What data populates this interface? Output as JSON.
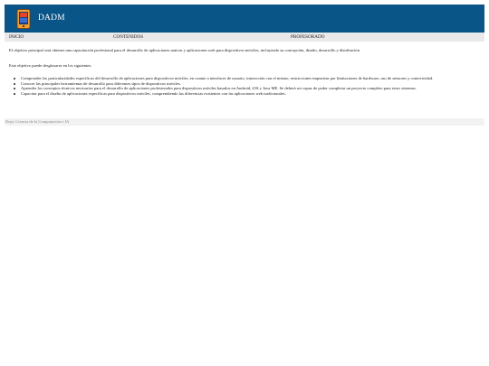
{
  "header": {
    "title": "DADM",
    "logo_icon": "device-logo-icon",
    "background_color": "#0a5587"
  },
  "nav": {
    "items": [
      {
        "label": "INICIO"
      },
      {
        "label": "CONTENIDOS"
      },
      {
        "label": "PROFESORADO"
      }
    ]
  },
  "main": {
    "intro": "El objetivo principal será obtener una capacitación profesional para el desarrollo de aplicaciones nativas y aplicaciones web para dispositivos móviles, incluyendo su concepción, diseño, desarrollo y distribución.",
    "lead": "Este objetivo puede desglosarse en los siguientes:",
    "goals": [
      "Comprender las particularidades específicas del desarrollo de aplicaciones para dispositivos móviles, en cuanto a interfaces de usuario, interacción con el mismo, restricciones impuestas por limitaciones de hardware, uso de sensores y conectividad.",
      "Conocer las principales herramientas de desarrollo para diferentes tipos de dispositivos móviles.",
      "Aprender los conceptos técnicos necesarios para el desarrollo de aplicaciones profesionales para dispositivos móviles basados en Android, iOS y Java ME. Se deberá ser capaz de poder completar un proyecto completo para estos sistemas.",
      "Capacitar para el diseño de aplicaciones específicas para dispositivos móviles, comprendiendo las diferencias existentes con las aplicaciones web tradicionales."
    ]
  },
  "footer": {
    "text": "Dept. Ciencia de la Computación e IA"
  }
}
